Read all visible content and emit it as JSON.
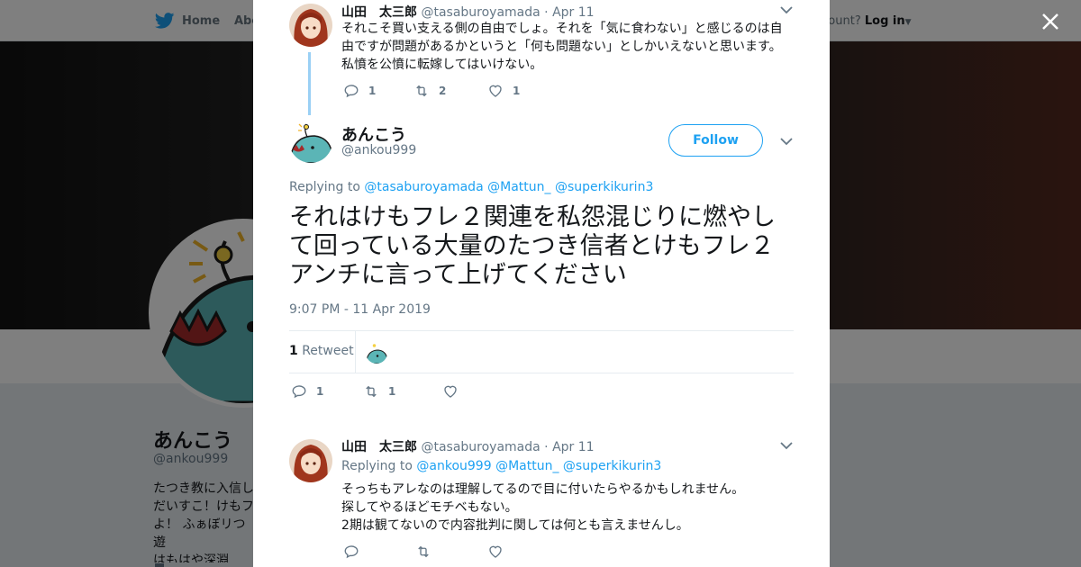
{
  "background_page": {
    "nav": {
      "home_label": "Home",
      "about_label": "Abo",
      "account_prompt": "ccount?",
      "login_label": "Log in"
    },
    "profile": {
      "display_name": "あんこう",
      "handle": "@ankou999",
      "bio": "たつき教に入信し\nだいすこ！けもフ\nよ！ ふぁぼリつ遊\nはもはや深淵"
    }
  },
  "modal": {
    "parent_tweet": {
      "name": "山田　太三郎",
      "handle": "@tasaburoyamada",
      "date": "Apr 11",
      "text": "それこそ買い支える側の自由でしょ。それを「気に食わない」と感じるのは自\n由ですが問題があるかというと「何も問題ない」としかいえないと思います。\n私憤を公憤に転嫁してはいけない。",
      "replies": "1",
      "retweets": "2",
      "likes": "1"
    },
    "main_tweet": {
      "name": "あんこう",
      "handle": "@ankou999",
      "follow_label": "Follow",
      "replying_prefix": "Replying to",
      "mentions": [
        "@tasaburoyamada",
        "@Mattun_",
        "@superkikurin3"
      ],
      "text": "それはけもフレ２関連を私怨混じりに燃やして回っている大量のたつき信者とけもフレ２アンチに言って上げてください",
      "timestamp": "9:07 PM - 11 Apr 2019",
      "retweet_count": "1",
      "retweet_label": "Retweet",
      "replies": "1",
      "retweets": "1",
      "likes": ""
    },
    "reply_tweet": {
      "name": "山田　太三郎",
      "handle": "@tasaburoyamada",
      "date": "Apr 11",
      "replying_prefix": "Replying to",
      "mentions": [
        "@ankou999",
        "@Mattun_",
        "@superkikurin3"
      ],
      "text": "そっちもアレなのは理解してるので目に付いたらやるかもしれません。\n探してやるほどモチベもない。\n2期は観てないので内容批判に関しては何とも言えませんし。",
      "replies": "",
      "retweets": "",
      "likes": ""
    }
  },
  "colors": {
    "twitter_blue": "#1da1f2",
    "thread_line": "#9ad0f5",
    "text_secondary": "#657786"
  },
  "icons": [
    "twitter-bird-icon",
    "close-icon",
    "reply-icon",
    "retweet-icon",
    "like-icon",
    "chevron-down-icon"
  ]
}
